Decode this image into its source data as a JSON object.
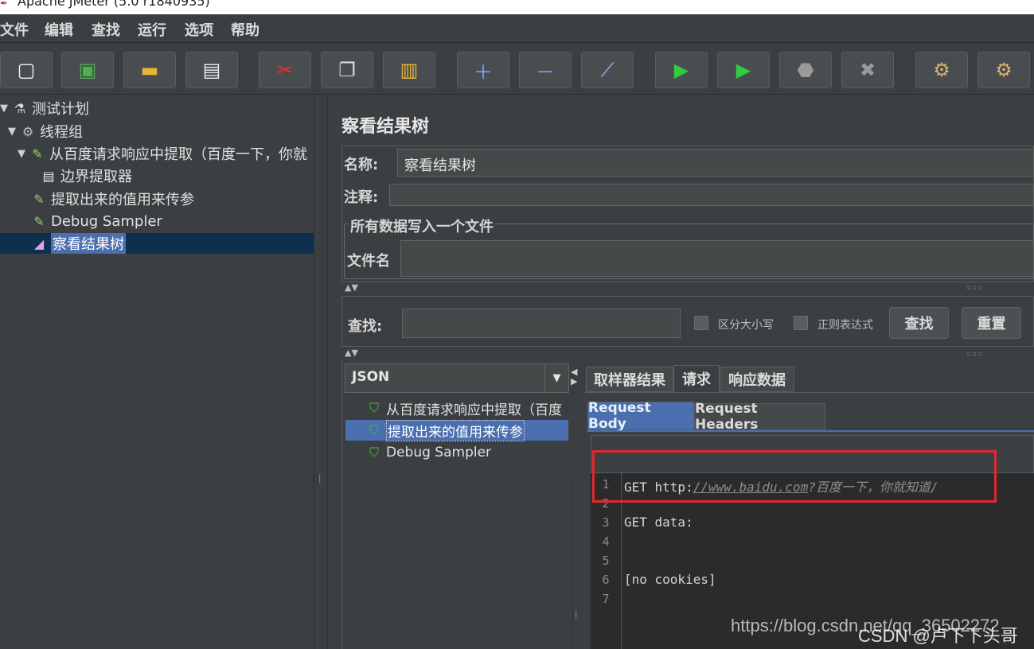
{
  "window": {
    "title": "Apache JMeter (5.0 r1840935)"
  },
  "menu": [
    "文件",
    "编辑",
    "查找",
    "运行",
    "选项",
    "帮助"
  ],
  "tree": {
    "items": [
      {
        "label": "测试计划"
      },
      {
        "label": "线程组"
      },
      {
        "label": "从百度请求响应中提取（百度一下，你就"
      },
      {
        "label": "边界提取器"
      },
      {
        "label": "提取出来的值用来传参"
      },
      {
        "label": "Debug Sampler"
      },
      {
        "label": "察看结果树"
      }
    ]
  },
  "panel": {
    "title": "察看结果树",
    "name_label": "名称:",
    "name_value": "察看结果树",
    "comment_label": "注释:",
    "file_group": "所有数据写入一个文件",
    "filename_label": "文件名",
    "search_label": "查找:",
    "case_label": "区分大小写",
    "regex_label": "正则表达式",
    "search_button": "查找",
    "reset_button": "重置",
    "renderer": "JSON"
  },
  "results": [
    {
      "label": "从百度请求响应中提取（百度"
    },
    {
      "label": "提取出来的值用来传参"
    },
    {
      "label": "Debug Sampler"
    }
  ],
  "tabs": [
    "取样器结果",
    "请求",
    "响应数据"
  ],
  "subtabs": [
    "Request Body",
    "Request Headers"
  ],
  "code": {
    "line_numbers": [
      "1",
      "2",
      "3",
      "4",
      "5",
      "6",
      "7"
    ],
    "l1_prefix": "GET http:",
    "l1_url": "//www.baidu.com",
    "l1_rest": "?百度一下，你就知道/",
    "l3": "GET data:",
    "l6": "[no cookies]"
  },
  "watermark": {
    "a": "https://blog.csdn.net/qq_36502272",
    "b": "CSDN @卢下下头哥"
  },
  "colors": {
    "highlight": "#e0282e",
    "selection": "#4b6eaf"
  }
}
